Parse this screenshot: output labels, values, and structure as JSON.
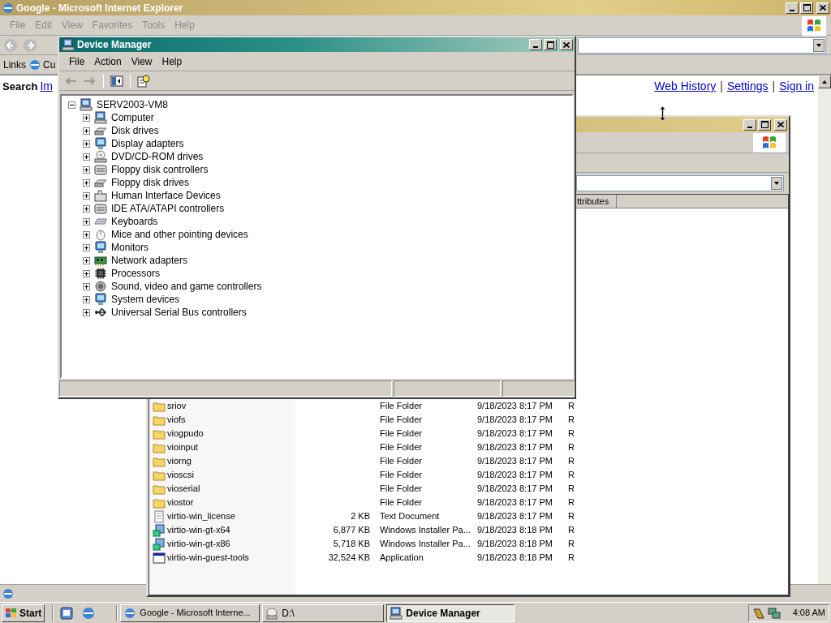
{
  "browser": {
    "title": "Google - Microsoft Internet Explorer",
    "menu": [
      "File",
      "Edit",
      "View",
      "Favorites",
      "Tools",
      "Help"
    ],
    "links_label": "Links",
    "link_item": "Cu",
    "search_label": "Search",
    "search_tab": "Im",
    "header_links": [
      {
        "kind": "link",
        "text": "Web History"
      },
      {
        "kind": "separator",
        "text": "|"
      },
      {
        "kind": "link",
        "text": "Settings"
      },
      {
        "kind": "separator",
        "text": "|"
      },
      {
        "kind": "link",
        "text": "Sign in"
      }
    ]
  },
  "explorer": {
    "column_header": "ttributes",
    "files": [
      {
        "name": "sriov",
        "kind": "folder",
        "type": "File Folder",
        "modified": "9/18/2023 8:17 PM",
        "attributes": "R"
      },
      {
        "name": "viofs",
        "kind": "folder",
        "type": "File Folder",
        "modified": "9/18/2023 8:17 PM",
        "attributes": "R"
      },
      {
        "name": "viogpudo",
        "kind": "folder",
        "type": "File Folder",
        "modified": "9/18/2023 8:17 PM",
        "attributes": "R"
      },
      {
        "name": "vioinput",
        "kind": "folder",
        "type": "File Folder",
        "modified": "9/18/2023 8:17 PM",
        "attributes": "R"
      },
      {
        "name": "viorng",
        "kind": "folder",
        "type": "File Folder",
        "modified": "9/18/2023 8:17 PM",
        "attributes": "R"
      },
      {
        "name": "vioscsi",
        "kind": "folder",
        "type": "File Folder",
        "modified": "9/18/2023 8:17 PM",
        "attributes": "R"
      },
      {
        "name": "vioserial",
        "kind": "folder",
        "type": "File Folder",
        "modified": "9/18/2023 8:17 PM",
        "attributes": "R"
      },
      {
        "name": "viostor",
        "kind": "folder",
        "type": "File Folder",
        "modified": "9/18/2023 8:17 PM",
        "attributes": "R"
      },
      {
        "name": "virtio-win_license",
        "kind": "text",
        "size": "2 KB",
        "type": "Text Document",
        "modified": "9/18/2023 8:17 PM",
        "attributes": "R"
      },
      {
        "name": "virtio-win-gt-x64",
        "kind": "installer",
        "size": "6,877 KB",
        "type": "Windows Installer Pa...",
        "modified": "9/18/2023 8:18 PM",
        "attributes": "R"
      },
      {
        "name": "virtio-win-gt-x86",
        "kind": "installer",
        "size": "5,718 KB",
        "type": "Windows Installer Pa...",
        "modified": "9/18/2023 8:18 PM",
        "attributes": "R"
      },
      {
        "name": "virtio-win-guest-tools",
        "kind": "app",
        "size": "32,524 KB",
        "type": "Application",
        "modified": "9/18/2023 8:18 PM",
        "attributes": "R"
      }
    ]
  },
  "device_manager": {
    "title": "Device Manager",
    "menu": [
      "File",
      "Action",
      "View",
      "Help"
    ],
    "tree": {
      "label": "SERV2003-VM8",
      "kind": "computer",
      "expanded": true,
      "children": [
        {
          "label": "Computer",
          "kind": "computer",
          "expanded": false
        },
        {
          "label": "Disk drives",
          "kind": "disk",
          "expanded": false
        },
        {
          "label": "Display adapters",
          "kind": "monitor",
          "expanded": false
        },
        {
          "label": "DVD/CD-ROM drives",
          "kind": "optical",
          "expanded": false
        },
        {
          "label": "Floppy disk controllers",
          "kind": "controller",
          "expanded": false
        },
        {
          "label": "Floppy disk drives",
          "kind": "disk",
          "expanded": false
        },
        {
          "label": "Human Interface Devices",
          "kind": "hid",
          "expanded": false
        },
        {
          "label": "IDE ATA/ATAPI controllers",
          "kind": "controller",
          "expanded": false
        },
        {
          "label": "Keyboards",
          "kind": "keyboard",
          "expanded": false
        },
        {
          "label": "Mice and other pointing devices",
          "kind": "mouse",
          "expanded": false
        },
        {
          "label": "Monitors",
          "kind": "monitor",
          "expanded": false
        },
        {
          "label": "Network adapters",
          "kind": "network",
          "expanded": false
        },
        {
          "label": "Processors",
          "kind": "processor",
          "expanded": false
        },
        {
          "label": "Sound, video and game controllers",
          "kind": "sound",
          "expanded": false
        },
        {
          "label": "System devices",
          "kind": "monitor",
          "expanded": false
        },
        {
          "label": "Universal Serial Bus controllers",
          "kind": "usb",
          "expanded": false
        }
      ]
    }
  },
  "taskbar": {
    "start": "Start",
    "tasks": [
      {
        "label": "Google - Microsoft Interne...",
        "kind": "browser",
        "selected": false
      },
      {
        "label": "D:\\",
        "kind": "drive",
        "selected": false
      },
      {
        "label": "Device Manager",
        "kind": "device-manager",
        "selected": true
      }
    ],
    "clock": "4:08 AM"
  }
}
